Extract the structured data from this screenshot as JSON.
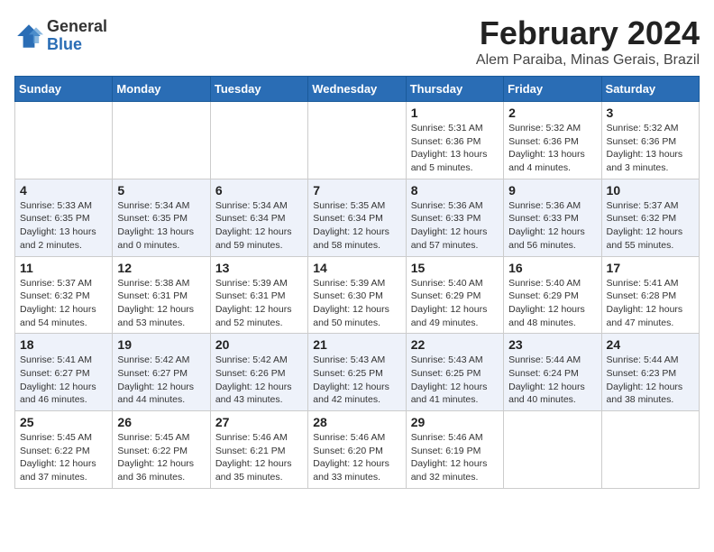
{
  "header": {
    "logo_general": "General",
    "logo_blue": "Blue",
    "month_year": "February 2024",
    "location": "Alem Paraiba, Minas Gerais, Brazil"
  },
  "days_of_week": [
    "Sunday",
    "Monday",
    "Tuesday",
    "Wednesday",
    "Thursday",
    "Friday",
    "Saturday"
  ],
  "weeks": [
    [
      {
        "day": "",
        "info": ""
      },
      {
        "day": "",
        "info": ""
      },
      {
        "day": "",
        "info": ""
      },
      {
        "day": "",
        "info": ""
      },
      {
        "day": "1",
        "info": "Sunrise: 5:31 AM\nSunset: 6:36 PM\nDaylight: 13 hours\nand 5 minutes."
      },
      {
        "day": "2",
        "info": "Sunrise: 5:32 AM\nSunset: 6:36 PM\nDaylight: 13 hours\nand 4 minutes."
      },
      {
        "day": "3",
        "info": "Sunrise: 5:32 AM\nSunset: 6:36 PM\nDaylight: 13 hours\nand 3 minutes."
      }
    ],
    [
      {
        "day": "4",
        "info": "Sunrise: 5:33 AM\nSunset: 6:35 PM\nDaylight: 13 hours\nand 2 minutes."
      },
      {
        "day": "5",
        "info": "Sunrise: 5:34 AM\nSunset: 6:35 PM\nDaylight: 13 hours\nand 0 minutes."
      },
      {
        "day": "6",
        "info": "Sunrise: 5:34 AM\nSunset: 6:34 PM\nDaylight: 12 hours\nand 59 minutes."
      },
      {
        "day": "7",
        "info": "Sunrise: 5:35 AM\nSunset: 6:34 PM\nDaylight: 12 hours\nand 58 minutes."
      },
      {
        "day": "8",
        "info": "Sunrise: 5:36 AM\nSunset: 6:33 PM\nDaylight: 12 hours\nand 57 minutes."
      },
      {
        "day": "9",
        "info": "Sunrise: 5:36 AM\nSunset: 6:33 PM\nDaylight: 12 hours\nand 56 minutes."
      },
      {
        "day": "10",
        "info": "Sunrise: 5:37 AM\nSunset: 6:32 PM\nDaylight: 12 hours\nand 55 minutes."
      }
    ],
    [
      {
        "day": "11",
        "info": "Sunrise: 5:37 AM\nSunset: 6:32 PM\nDaylight: 12 hours\nand 54 minutes."
      },
      {
        "day": "12",
        "info": "Sunrise: 5:38 AM\nSunset: 6:31 PM\nDaylight: 12 hours\nand 53 minutes."
      },
      {
        "day": "13",
        "info": "Sunrise: 5:39 AM\nSunset: 6:31 PM\nDaylight: 12 hours\nand 52 minutes."
      },
      {
        "day": "14",
        "info": "Sunrise: 5:39 AM\nSunset: 6:30 PM\nDaylight: 12 hours\nand 50 minutes."
      },
      {
        "day": "15",
        "info": "Sunrise: 5:40 AM\nSunset: 6:29 PM\nDaylight: 12 hours\nand 49 minutes."
      },
      {
        "day": "16",
        "info": "Sunrise: 5:40 AM\nSunset: 6:29 PM\nDaylight: 12 hours\nand 48 minutes."
      },
      {
        "day": "17",
        "info": "Sunrise: 5:41 AM\nSunset: 6:28 PM\nDaylight: 12 hours\nand 47 minutes."
      }
    ],
    [
      {
        "day": "18",
        "info": "Sunrise: 5:41 AM\nSunset: 6:27 PM\nDaylight: 12 hours\nand 46 minutes."
      },
      {
        "day": "19",
        "info": "Sunrise: 5:42 AM\nSunset: 6:27 PM\nDaylight: 12 hours\nand 44 minutes."
      },
      {
        "day": "20",
        "info": "Sunrise: 5:42 AM\nSunset: 6:26 PM\nDaylight: 12 hours\nand 43 minutes."
      },
      {
        "day": "21",
        "info": "Sunrise: 5:43 AM\nSunset: 6:25 PM\nDaylight: 12 hours\nand 42 minutes."
      },
      {
        "day": "22",
        "info": "Sunrise: 5:43 AM\nSunset: 6:25 PM\nDaylight: 12 hours\nand 41 minutes."
      },
      {
        "day": "23",
        "info": "Sunrise: 5:44 AM\nSunset: 6:24 PM\nDaylight: 12 hours\nand 40 minutes."
      },
      {
        "day": "24",
        "info": "Sunrise: 5:44 AM\nSunset: 6:23 PM\nDaylight: 12 hours\nand 38 minutes."
      }
    ],
    [
      {
        "day": "25",
        "info": "Sunrise: 5:45 AM\nSunset: 6:22 PM\nDaylight: 12 hours\nand 37 minutes."
      },
      {
        "day": "26",
        "info": "Sunrise: 5:45 AM\nSunset: 6:22 PM\nDaylight: 12 hours\nand 36 minutes."
      },
      {
        "day": "27",
        "info": "Sunrise: 5:46 AM\nSunset: 6:21 PM\nDaylight: 12 hours\nand 35 minutes."
      },
      {
        "day": "28",
        "info": "Sunrise: 5:46 AM\nSunset: 6:20 PM\nDaylight: 12 hours\nand 33 minutes."
      },
      {
        "day": "29",
        "info": "Sunrise: 5:46 AM\nSunset: 6:19 PM\nDaylight: 12 hours\nand 32 minutes."
      },
      {
        "day": "",
        "info": ""
      },
      {
        "day": "",
        "info": ""
      }
    ]
  ]
}
